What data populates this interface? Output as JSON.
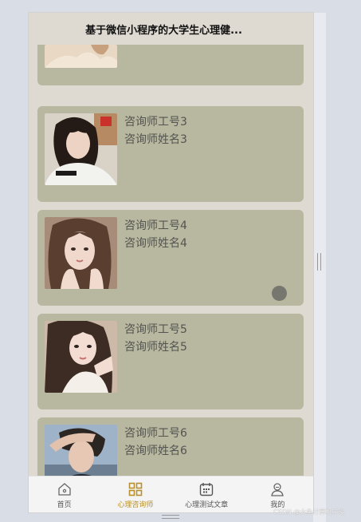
{
  "header": {
    "title": "基于微信小程序的大学生心理健..."
  },
  "cards": [
    {
      "id_text": "咨询师工号3",
      "name_text": "咨询师姓名3"
    },
    {
      "id_text": "咨询师工号4",
      "name_text": "咨询师姓名4"
    },
    {
      "id_text": "咨询师工号5",
      "name_text": "咨询师姓名5"
    },
    {
      "id_text": "咨询师工号6",
      "name_text": "咨询师姓名6"
    }
  ],
  "tabbar": {
    "items": [
      {
        "label": "首页",
        "icon": "home-icon"
      },
      {
        "label": "心理咨询师",
        "icon": "grid-icon",
        "active": true
      },
      {
        "label": "心理测试文章",
        "icon": "calendar-icon"
      },
      {
        "label": "我的",
        "icon": "user-icon"
      }
    ]
  },
  "watermark": "CSDN @大鱼计算机毕设",
  "colors": {
    "card": "#b8b79f",
    "phone_bg": "#dedad2",
    "active_tab": "#b8902e"
  }
}
